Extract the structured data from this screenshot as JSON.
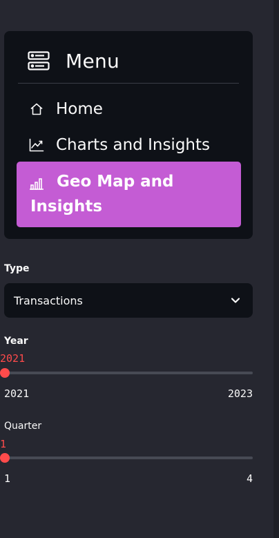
{
  "sidebar": {
    "menu": {
      "title": "Menu",
      "items": [
        {
          "label": "Home",
          "icon": "house-icon",
          "selected": false
        },
        {
          "label": "Charts and Insights",
          "icon": "graph-up-icon",
          "selected": false
        },
        {
          "label": "Geo Map and Insights",
          "icon": "bar-chart-icon",
          "selected": true
        }
      ]
    },
    "type_select": {
      "label": "Type",
      "value": "Transactions"
    },
    "year_slider": {
      "label": "Year",
      "value": "2021",
      "min": "2021",
      "max": "2023",
      "fraction": 0.0
    },
    "quarter_slider": {
      "label": "Quarter",
      "value": "1",
      "min": "1",
      "max": "4",
      "fraction": 0.0
    }
  },
  "colors": {
    "sidebar_bg": "#262730",
    "card_bg": "#0e1117",
    "selected_item_bg": "#c45cd4",
    "accent": "#ff4b4b"
  }
}
